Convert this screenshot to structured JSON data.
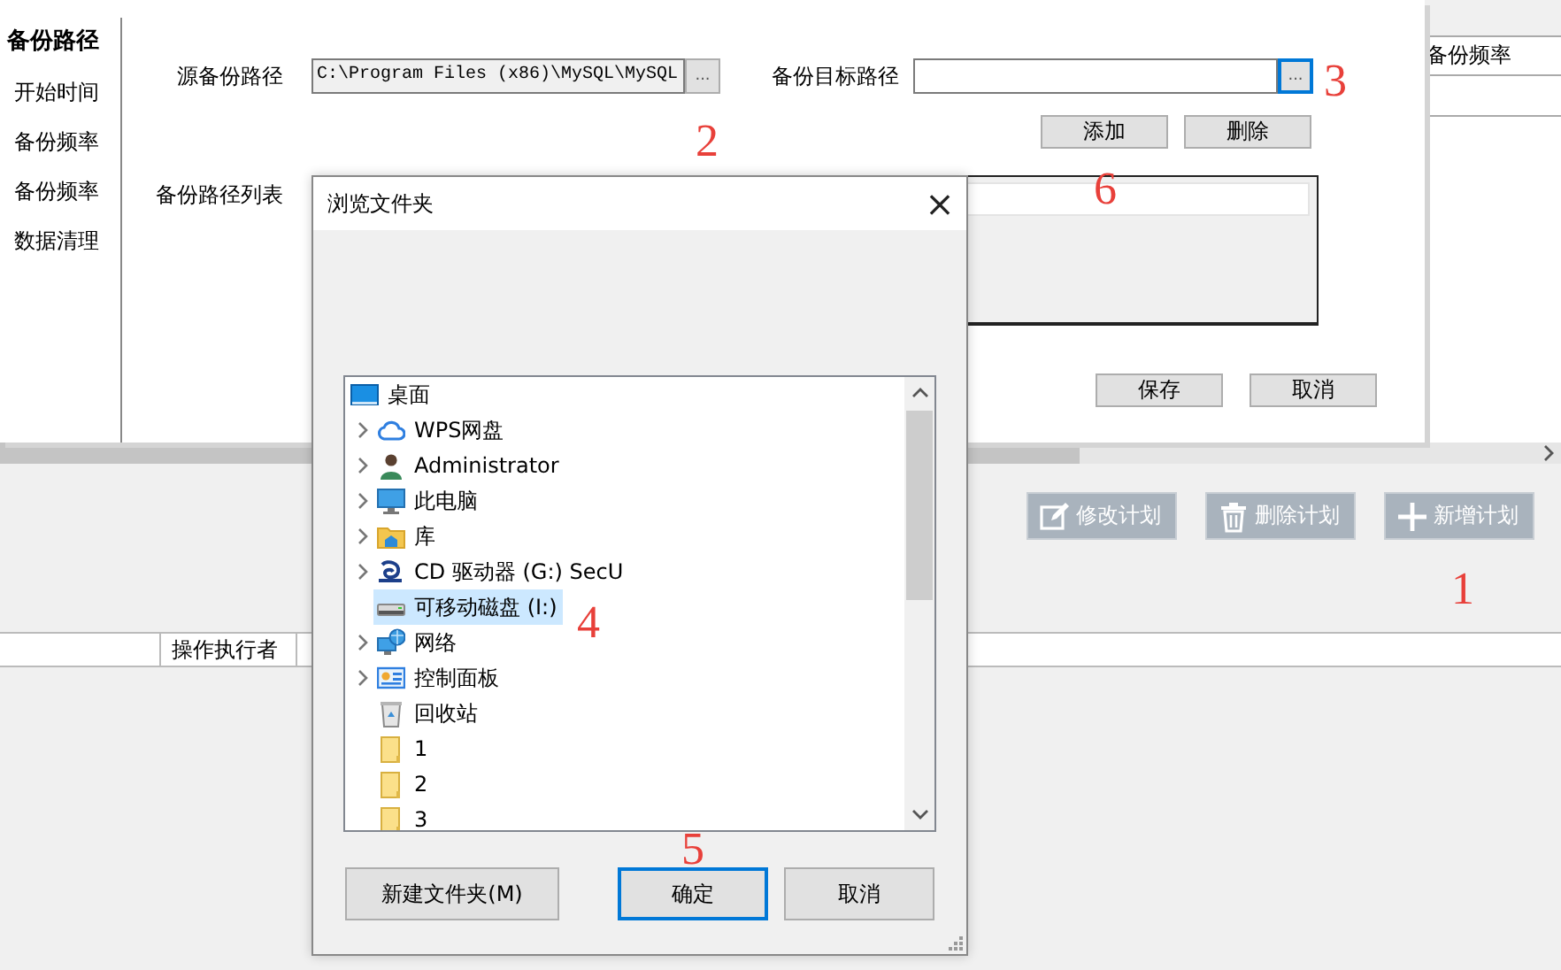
{
  "background_window": {
    "table_header": "备份频率",
    "plan_buttons": [
      {
        "label": "修改计划"
      },
      {
        "label": "删除计划"
      },
      {
        "label": "新增计划"
      }
    ],
    "log_table": {
      "columns": [
        "操作执行者"
      ]
    }
  },
  "settings_dialog": {
    "nav_items": [
      {
        "label": "备份路径",
        "selected": true
      },
      {
        "label": "开始时间",
        "selected": false
      },
      {
        "label": "备份频率",
        "selected": false
      },
      {
        "label": "备份频率",
        "selected": false
      },
      {
        "label": "数据清理",
        "selected": false
      }
    ],
    "source_path": {
      "label": "源备份路径",
      "value": "C:\\Program Files (x86)\\MySQL\\MySQL",
      "browse_button": "...",
      "focused": false
    },
    "target_path": {
      "label": "备份目标路径",
      "browse_button": "...",
      "focused": true
    },
    "add_button": "添加",
    "delete_button": "删除",
    "path_list": {
      "label": "备份路径列表"
    },
    "save_button": "保存",
    "cancel_button": "取消"
  },
  "browse_dialog": {
    "title": "浏览文件夹",
    "close": "×",
    "tree": [
      {
        "label": "桌面",
        "expandable": false,
        "selected": false,
        "children": [
          {
            "label": "WPS网盘",
            "expandable": true,
            "selected": false
          },
          {
            "label": "Administrator",
            "expandable": true,
            "selected": false
          },
          {
            "label": "此电脑",
            "expandable": true,
            "selected": false
          },
          {
            "label": "库",
            "expandable": true,
            "selected": false
          },
          {
            "label": "CD 驱动器 (G:) SecU",
            "expandable": true,
            "selected": false
          },
          {
            "label": "可移动磁盘 (I:)",
            "expandable": false,
            "selected": true
          },
          {
            "label": "网络",
            "expandable": true,
            "selected": false
          },
          {
            "label": "控制面板",
            "expandable": true,
            "selected": false
          },
          {
            "label": "回收站",
            "expandable": false,
            "selected": false
          },
          {
            "label": "1",
            "expandable": false,
            "selected": false
          },
          {
            "label": "2",
            "expandable": false,
            "selected": false
          },
          {
            "label": "3",
            "expandable": false,
            "selected": false
          }
        ]
      }
    ],
    "buttons": [
      {
        "label": "新建文件夹(M)",
        "default": false
      },
      {
        "label": "确定",
        "default": true
      },
      {
        "label": "取消",
        "default": false
      }
    ]
  },
  "annotations": [
    {
      "text": "1"
    },
    {
      "text": "2"
    },
    {
      "text": "3"
    },
    {
      "text": "4"
    },
    {
      "text": "5"
    },
    {
      "text": "6"
    }
  ]
}
